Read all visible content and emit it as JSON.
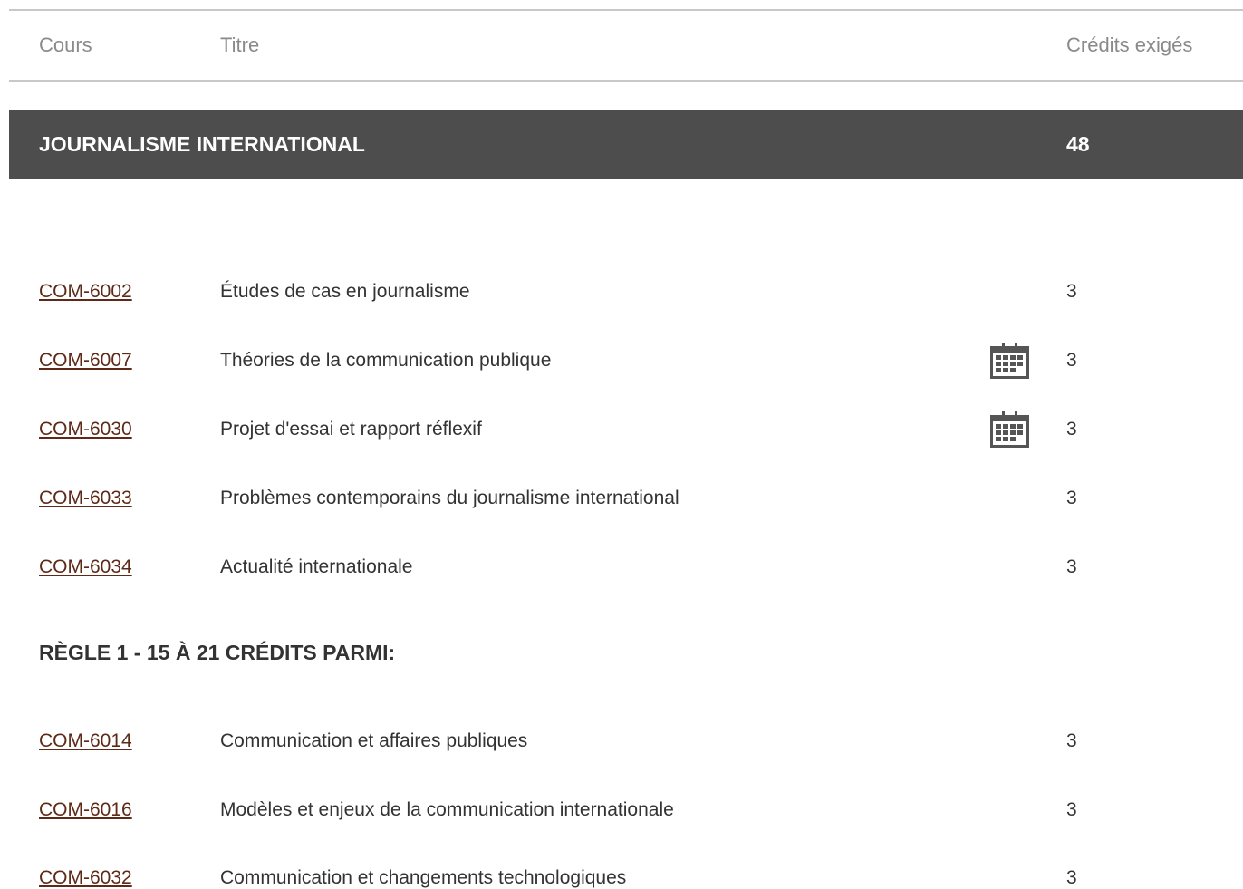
{
  "header": {
    "col_course": "Cours",
    "col_title": "Titre",
    "col_credits": "Crédits exigés"
  },
  "section": {
    "title": "JOURNALISME INTERNATIONAL",
    "credits": "48"
  },
  "courses_main": [
    {
      "code": "COM-6002",
      "title": "Études de cas en journalisme",
      "credits": "3",
      "calendar": false
    },
    {
      "code": "COM-6007",
      "title": "Théories de la communication publique",
      "credits": "3",
      "calendar": true
    },
    {
      "code": "COM-6030",
      "title": "Projet d'essai et rapport réflexif",
      "credits": "3",
      "calendar": true
    },
    {
      "code": "COM-6033",
      "title": "Problèmes contemporains du journalisme international",
      "credits": "3",
      "calendar": false
    },
    {
      "code": "COM-6034",
      "title": "Actualité internationale",
      "credits": "3",
      "calendar": false
    }
  ],
  "rule1": {
    "heading": "RÈGLE 1 - 15 À 21 CRÉDITS PARMI:"
  },
  "courses_rule1": [
    {
      "code": "COM-6014",
      "title": "Communication et affaires publiques",
      "credits": "3"
    },
    {
      "code": "COM-6016",
      "title": "Modèles et enjeux de la communication internationale",
      "credits": "3"
    },
    {
      "code": "COM-6032",
      "title": "Communication et changements technologiques",
      "credits": "3"
    }
  ],
  "icons": {
    "calendar": "calendar-icon"
  },
  "colors": {
    "section_bar": "#4d4d4d",
    "link": "#5e2a17",
    "header_text": "#8a8a8a"
  }
}
